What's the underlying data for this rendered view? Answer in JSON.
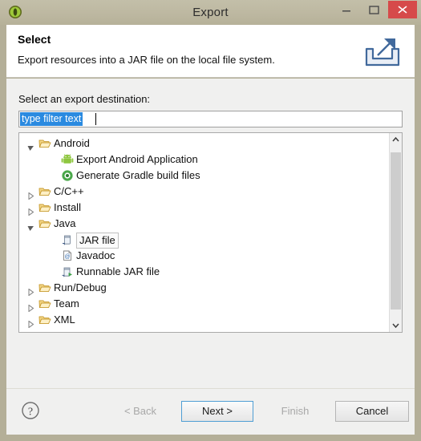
{
  "window": {
    "title": "Export",
    "app_icon": "eclipse-icon",
    "controls": {
      "minimize": "minimize-icon",
      "maximize": "maximize-icon",
      "close": "close-icon",
      "close_color": "#d64a4a"
    }
  },
  "header": {
    "title": "Select",
    "description": "Export resources into a JAR file on the local file system.",
    "icon": "export-icon"
  },
  "main": {
    "destination_label": "Select an export destination:",
    "filter": {
      "value": "type filter text",
      "placeholder": "type filter text",
      "selected": true,
      "selection_color": "#2a8ae0"
    },
    "tree": {
      "items": [
        {
          "label": "Android",
          "depth": 0,
          "twisty": "expanded",
          "icon": "folder-open-icon",
          "selected": false
        },
        {
          "label": "Export Android Application",
          "depth": 1,
          "twisty": "none",
          "icon": "android-icon",
          "selected": false
        },
        {
          "label": "Generate Gradle build files",
          "depth": 1,
          "twisty": "none",
          "icon": "gradle-icon",
          "selected": false
        },
        {
          "label": "C/C++",
          "depth": 0,
          "twisty": "collapsed",
          "icon": "folder-open-icon",
          "selected": false
        },
        {
          "label": "Install",
          "depth": 0,
          "twisty": "collapsed",
          "icon": "folder-open-icon",
          "selected": false
        },
        {
          "label": "Java",
          "depth": 0,
          "twisty": "expanded",
          "icon": "folder-open-icon",
          "selected": false
        },
        {
          "label": "JAR file",
          "depth": 1,
          "twisty": "none",
          "icon": "jar-file-icon",
          "selected": true
        },
        {
          "label": "Javadoc",
          "depth": 1,
          "twisty": "none",
          "icon": "javadoc-icon",
          "selected": false
        },
        {
          "label": "Runnable JAR file",
          "depth": 1,
          "twisty": "none",
          "icon": "runnable-jar-icon",
          "selected": false
        },
        {
          "label": "Run/Debug",
          "depth": 0,
          "twisty": "collapsed",
          "icon": "folder-open-icon",
          "selected": false
        },
        {
          "label": "Team",
          "depth": 0,
          "twisty": "collapsed",
          "icon": "folder-open-icon",
          "selected": false
        },
        {
          "label": "XML",
          "depth": 0,
          "twisty": "collapsed",
          "icon": "folder-open-icon",
          "selected": false
        }
      ],
      "scrollbar": {
        "up_arrow": "chevron-up-icon",
        "down_arrow": "chevron-down-icon"
      }
    }
  },
  "footer": {
    "help_icon": "help-icon",
    "buttons": [
      {
        "label": "< Back",
        "state": "disabled"
      },
      {
        "label": "Next >",
        "state": "default"
      },
      {
        "label": "Finish",
        "state": "disabled"
      },
      {
        "label": "Cancel",
        "state": "normal"
      }
    ]
  }
}
